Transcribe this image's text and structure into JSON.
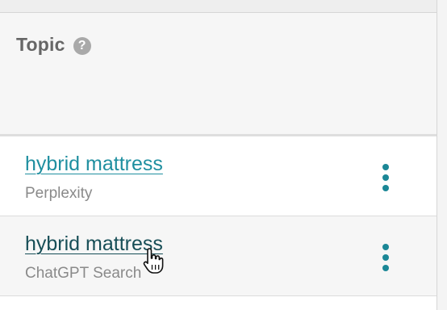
{
  "table": {
    "header": {
      "label": "Topic",
      "help_icon": "?"
    },
    "rows": [
      {
        "topic": "hybrid mattress",
        "source": "Perplexity",
        "menu_icon": "kebab-vertical-icon"
      },
      {
        "topic": "hybrid mattress",
        "source": "ChatGPT Search",
        "menu_icon": "kebab-vertical-icon"
      }
    ]
  },
  "colors": {
    "link": "#1f8fa0",
    "link_hover": "#174e57",
    "kebab": "#1b8796",
    "muted_text": "#8a8a8a",
    "header_text": "#666666"
  },
  "cursor": "pointer-hand-icon"
}
